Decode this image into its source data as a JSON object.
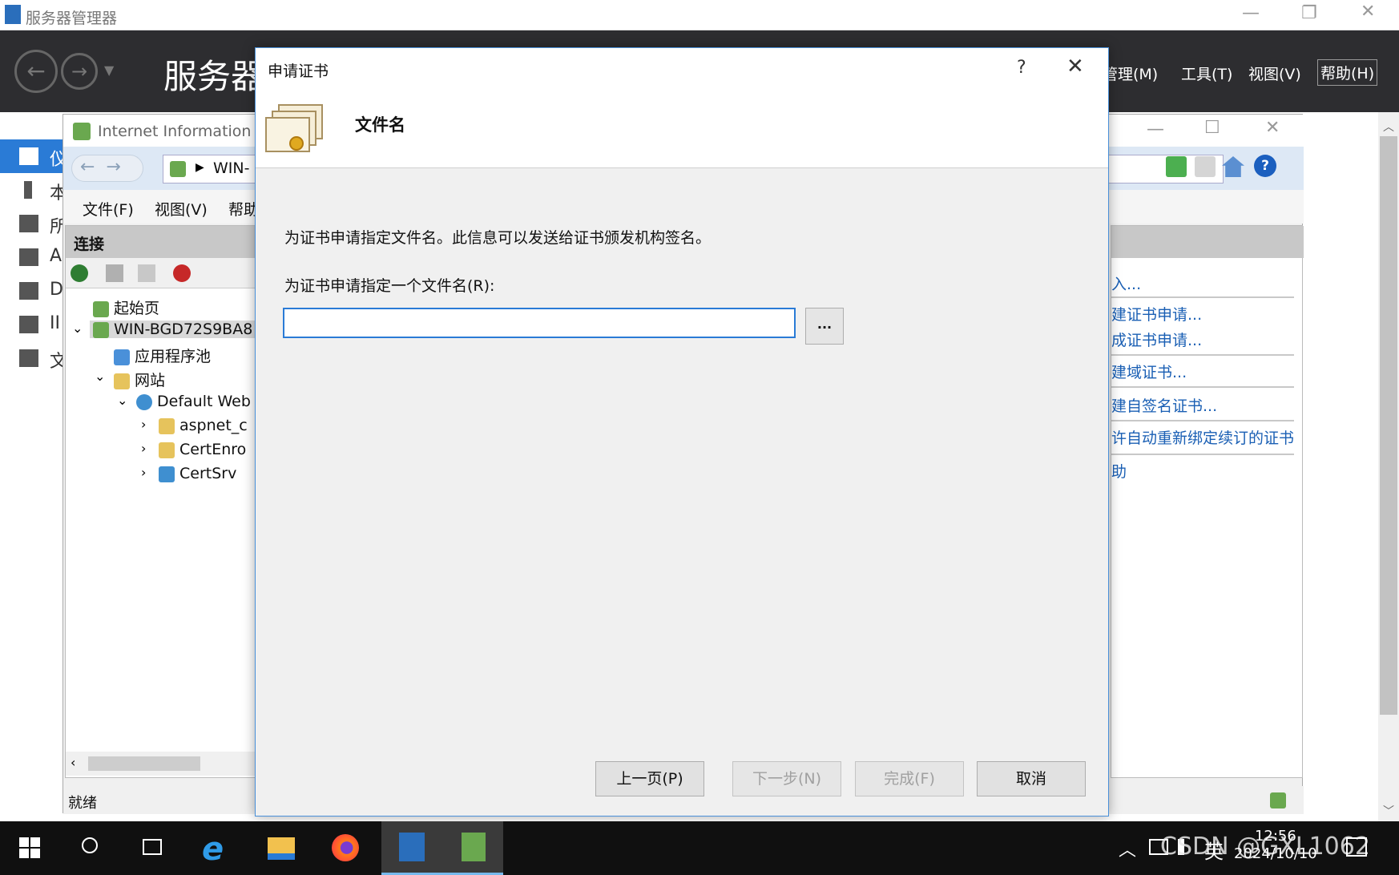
{
  "server_manager": {
    "title": "服务器管理器",
    "big_title": "服务器",
    "menus": [
      "管理(M)",
      "工具(T)",
      "视图(V)",
      "帮助(H)"
    ],
    "sidebar": [
      "仪",
      "本",
      "所",
      "A",
      "D",
      "II",
      "文"
    ]
  },
  "iis": {
    "title": "Internet Information S",
    "address": "WIN-",
    "menus": [
      "文件(F)",
      "视图(V)",
      "帮助"
    ],
    "connections_header": "连接",
    "tree": [
      {
        "label": "起始页"
      },
      {
        "label": "WIN-BGD72S9BA8"
      },
      {
        "label": "应用程序池"
      },
      {
        "label": "网站"
      },
      {
        "label": "Default Web"
      },
      {
        "label": "aspnet_c"
      },
      {
        "label": "CertEnro"
      },
      {
        "label": "CertSrv"
      }
    ],
    "actions": [
      "入...",
      "建证书申请...",
      "成证书申请...",
      "建域证书...",
      "建自签名证书...",
      "许自动重新绑定续订的证书",
      "助"
    ],
    "status": "就绪"
  },
  "dialog": {
    "title": "申请证书",
    "help": "?",
    "heading": "文件名",
    "description": "为证书申请指定文件名。此信息可以发送给证书颁发机构签名。",
    "field_label": "为证书申请指定一个文件名(R):",
    "field_value": "",
    "browse": "...",
    "buttons": {
      "prev": "上一页(P)",
      "next": "下一步(N)",
      "finish": "完成(F)",
      "cancel": "取消"
    }
  },
  "taskbar": {
    "time": "12:56",
    "date": "2024/10/10",
    "lang": "英",
    "watermark": "CSDN @GXL1062"
  }
}
